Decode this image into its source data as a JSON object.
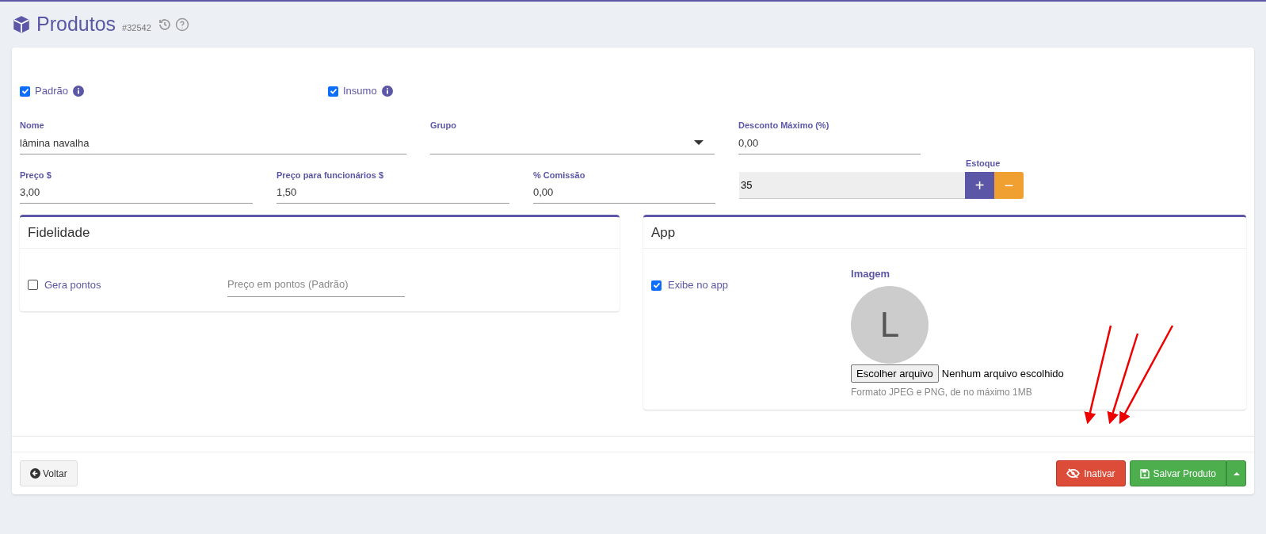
{
  "header": {
    "title": "Produtos",
    "id": "#32542"
  },
  "options": [
    {
      "label": "Padrão",
      "checked": true
    },
    {
      "label": "Insumo",
      "checked": true
    }
  ],
  "fields": [
    {
      "kind": "text",
      "label": "Nome",
      "value": "lâmina navalha"
    },
    {
      "kind": "select",
      "label": "Grupo"
    },
    {
      "kind": "text",
      "label": "Desconto Máximo (%)",
      "value": "0,00"
    },
    {
      "kind": "text",
      "label": "Preço $",
      "value": "3,00"
    },
    {
      "kind": "text",
      "label": "Preço para funcionários $",
      "value": "1,50"
    },
    {
      "kind": "text",
      "label": "% Comissão",
      "value": "0,00"
    },
    {
      "kind": "stock",
      "label": "Estoque",
      "value": "35",
      "plus": "+",
      "minus": "−"
    }
  ],
  "fidelidade": {
    "title": "Fidelidade",
    "checkbox": {
      "label": "Gera pontos",
      "checked": false
    },
    "points_placeholder": "Preço em pontos (Padrão)"
  },
  "app": {
    "title": "App",
    "checkbox": {
      "label": "Exibe no app",
      "checked": true
    },
    "image_label": "Imagem",
    "avatar_letter": "L",
    "file_button": "Escolher arquivo",
    "file_status": "Nenhum arquivo escolhido",
    "hint": "Formato JPEG e PNG, de no máximo 1MB"
  },
  "footer": {
    "back": "Voltar",
    "actions": [
      {
        "kind": "danger",
        "label": "Inativar"
      },
      {
        "kind": "success",
        "label": "Salvar Produto"
      }
    ]
  }
}
